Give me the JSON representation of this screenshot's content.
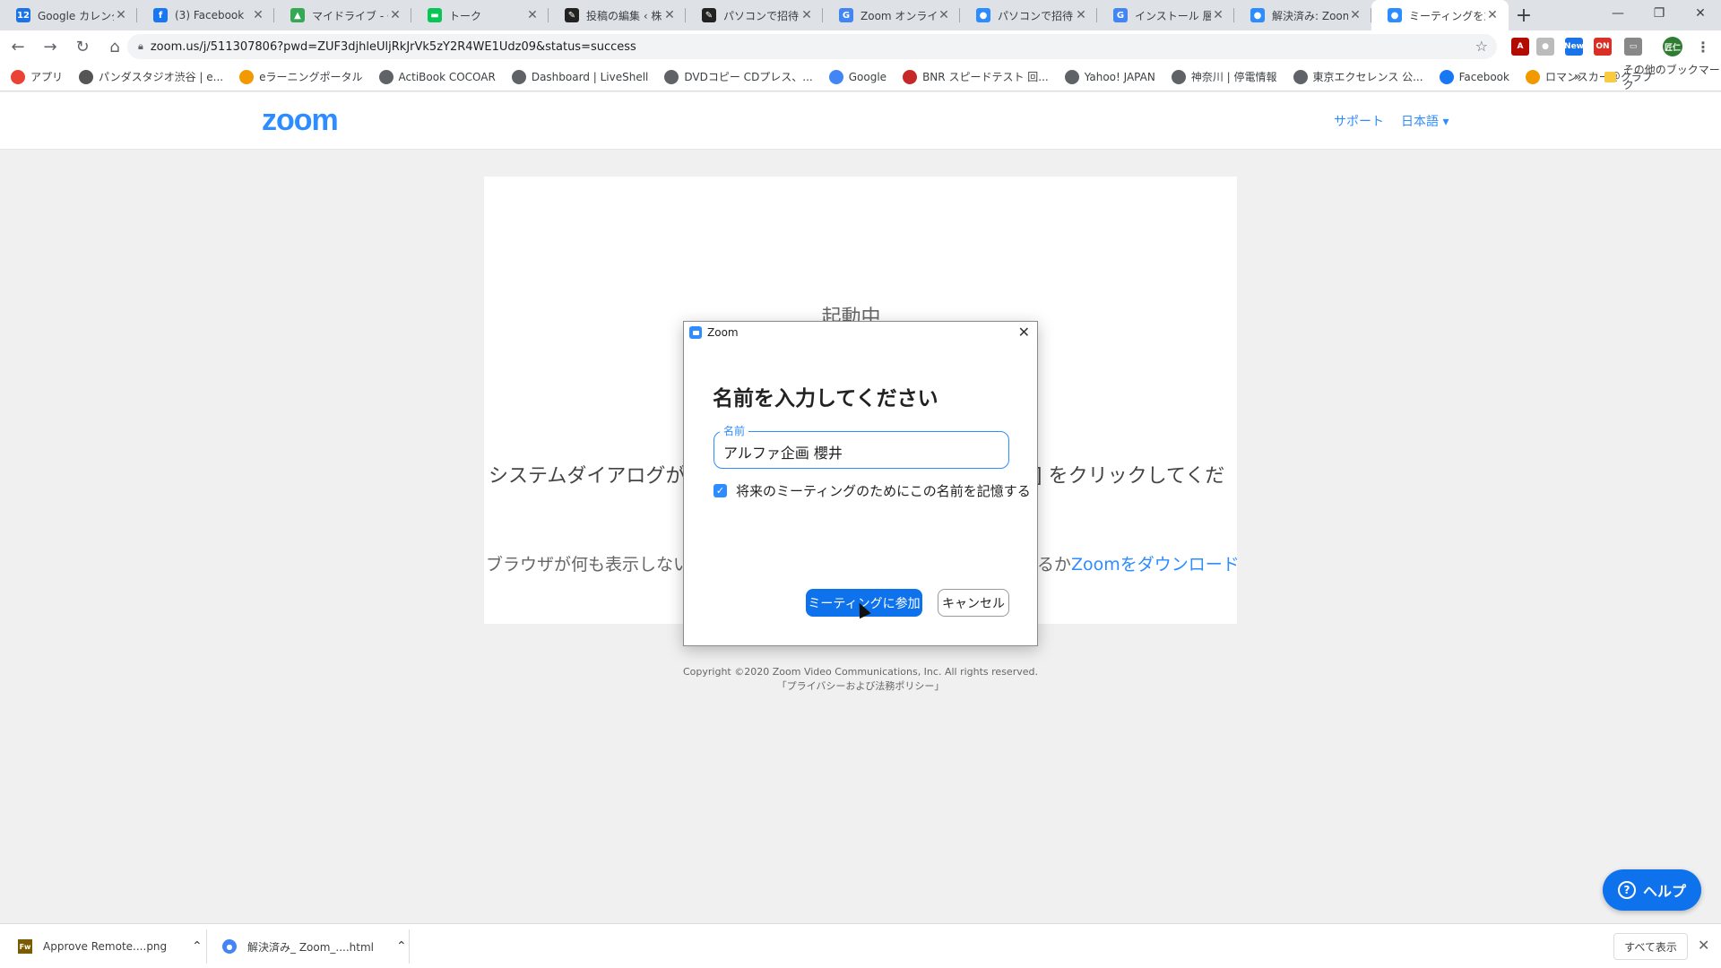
{
  "browser": {
    "tabs": [
      {
        "title": "Google カレンダー",
        "favicon": "12",
        "color": "#1a73e8"
      },
      {
        "title": "(3) Facebook",
        "favicon": "f",
        "color": "#1877f2"
      },
      {
        "title": "マイドライブ - Goog",
        "favicon": "▲",
        "color": "#34a853"
      },
      {
        "title": "トーク",
        "favicon": "▬",
        "color": "#06c755"
      },
      {
        "title": "投稿の編集 ‹ 株式",
        "favicon": "✎",
        "color": "#222222"
      },
      {
        "title": "パソコンで招待URL",
        "favicon": "✎",
        "color": "#222222"
      },
      {
        "title": "Zoom オンライン会",
        "favicon": "G",
        "color": "#4285f4"
      },
      {
        "title": "パソコンで招待URL",
        "favicon": "●",
        "color": "#2D8CFF"
      },
      {
        "title": "インストール 層 マ",
        "favicon": "G",
        "color": "#4285f4"
      },
      {
        "title": "解決済み: Zoom",
        "favicon": "●",
        "color": "#2D8CFF"
      },
      {
        "title": "ミーティングを立ち上",
        "favicon": "●",
        "color": "#2D8CFF",
        "active": true
      }
    ],
    "url": "zoom.us/j/511307806?pwd=ZUF3djhleUljRkJrVk5zY2R4WE1Udz09&status=success",
    "extensions": [
      {
        "name": "pdf-extension-icon",
        "label": "A",
        "color": "#b30b00"
      },
      {
        "name": "extension-icon",
        "label": "●",
        "color": "#bbbbbb"
      },
      {
        "name": "new-extension-icon",
        "label": "New",
        "color": "#1a73e8"
      },
      {
        "name": "on-extension-icon",
        "label": "ON",
        "color": "#d93025"
      },
      {
        "name": "screen-extension-icon",
        "label": "▭",
        "color": "#888888"
      },
      {
        "name": "profile-avatar",
        "label": "匠仁",
        "color": "#2e7d32"
      }
    ],
    "bookmarks": [
      {
        "label": "アプリ",
        "color": "#ea4335"
      },
      {
        "label": "パンダスタジオ渋谷 | e...",
        "color": "#555555"
      },
      {
        "label": "eラーニングポータル",
        "color": "#f29900"
      },
      {
        "label": "ActiBook COCOAR",
        "color": "#5f6368"
      },
      {
        "label": "Dashboard | LiveShell",
        "color": "#5f6368"
      },
      {
        "label": "DVDコピー CDプレス、...",
        "color": "#5f6368"
      },
      {
        "label": "Google",
        "color": "#4285f4"
      },
      {
        "label": "BNR スピードテスト 回...",
        "color": "#c62828"
      },
      {
        "label": "Yahoo! JAPAN",
        "color": "#5f6368"
      },
      {
        "label": "神奈川 | 停電情報",
        "color": "#5f6368"
      },
      {
        "label": "東京エクセレンス 公...",
        "color": "#5f6368"
      },
      {
        "label": "Facebook",
        "color": "#1877f2"
      },
      {
        "label": "ロマンスカー＠クラブ",
        "color": "#f29900"
      }
    ],
    "bookmarks_more": "»",
    "other_bookmarks": "その他のブックマーク"
  },
  "zoom": {
    "logo": "zoom",
    "support": "サポート",
    "language": "日本語 ▾",
    "launching": "起動中...",
    "system_msg_left": "システムダイアログが",
    "system_msg_right": "] をクリックしてくだ",
    "browser_msg_left": "ブラウザが何も表示しない場",
    "browser_msg_mid": "るか",
    "browser_msg_link": "Zoomをダウンロードし",
    "copyright": "Copyright ©2020 Zoom Video Communications, Inc. All rights reserved.",
    "privacy": "「プライバシーおよび法務ポリシー」",
    "help": "ヘルプ"
  },
  "dialog": {
    "title": "Zoom",
    "heading": "名前を入力してください",
    "field_label": "名前",
    "name_value": "アルファ企画 櫻井",
    "remember_label": "将来のミーティングのためにこの名前を記憶する",
    "remember_checked": true,
    "join_label": "ミーティングに参加",
    "cancel_label": "キャンセル"
  },
  "downloads": {
    "items": [
      {
        "name": "Approve Remote....png",
        "icon": "Fw",
        "color": "#7a5b00"
      },
      {
        "name": "解決済み_ Zoom_....html",
        "icon": "●",
        "color": "#4285f4"
      }
    ],
    "show_all": "すべて表示"
  }
}
